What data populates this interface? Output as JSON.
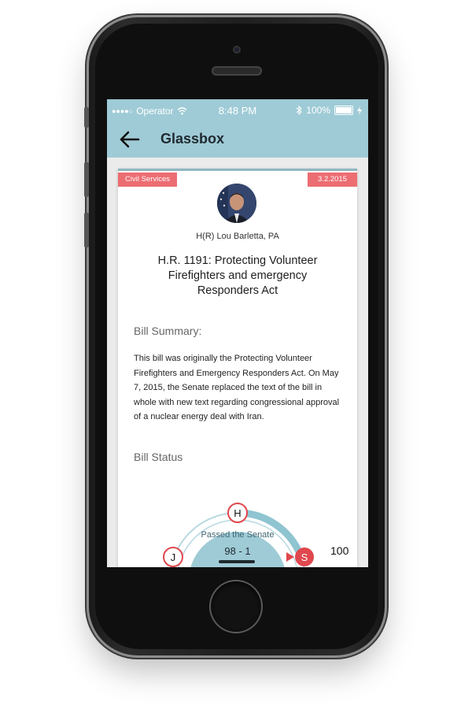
{
  "statusbar": {
    "carrier": "Operator",
    "time": "8:48 PM",
    "battery": "100%"
  },
  "nav": {
    "title": "Glassbox"
  },
  "bill": {
    "category": "Civil Services",
    "date": "3.2.2015",
    "sponsor": "H(R) Lou Barletta, PA",
    "title": "H.R. 1191: Protecting Volunteer Firefighters and emergency Responders Act",
    "summary_heading": "Bill Summary:",
    "summary": "This bill was originally the Protecting Volunteer Firefighters and Emergency Responders Act. On May 7, 2015, the Senate replaced the text of the bill in whole with new text regarding congressional approval of a nuclear energy deal with Iran.",
    "status_heading": "Bill Status"
  },
  "status": {
    "stage_label": "Passed the Senate",
    "vote": "98 - 1",
    "nodes": {
      "house": "H",
      "senate": "S",
      "judiciary": "J"
    },
    "senate_count": "100"
  },
  "colors": {
    "accent": "#9fcbd6",
    "tag": "#ec6d72",
    "node_ring": "#e0474e"
  }
}
